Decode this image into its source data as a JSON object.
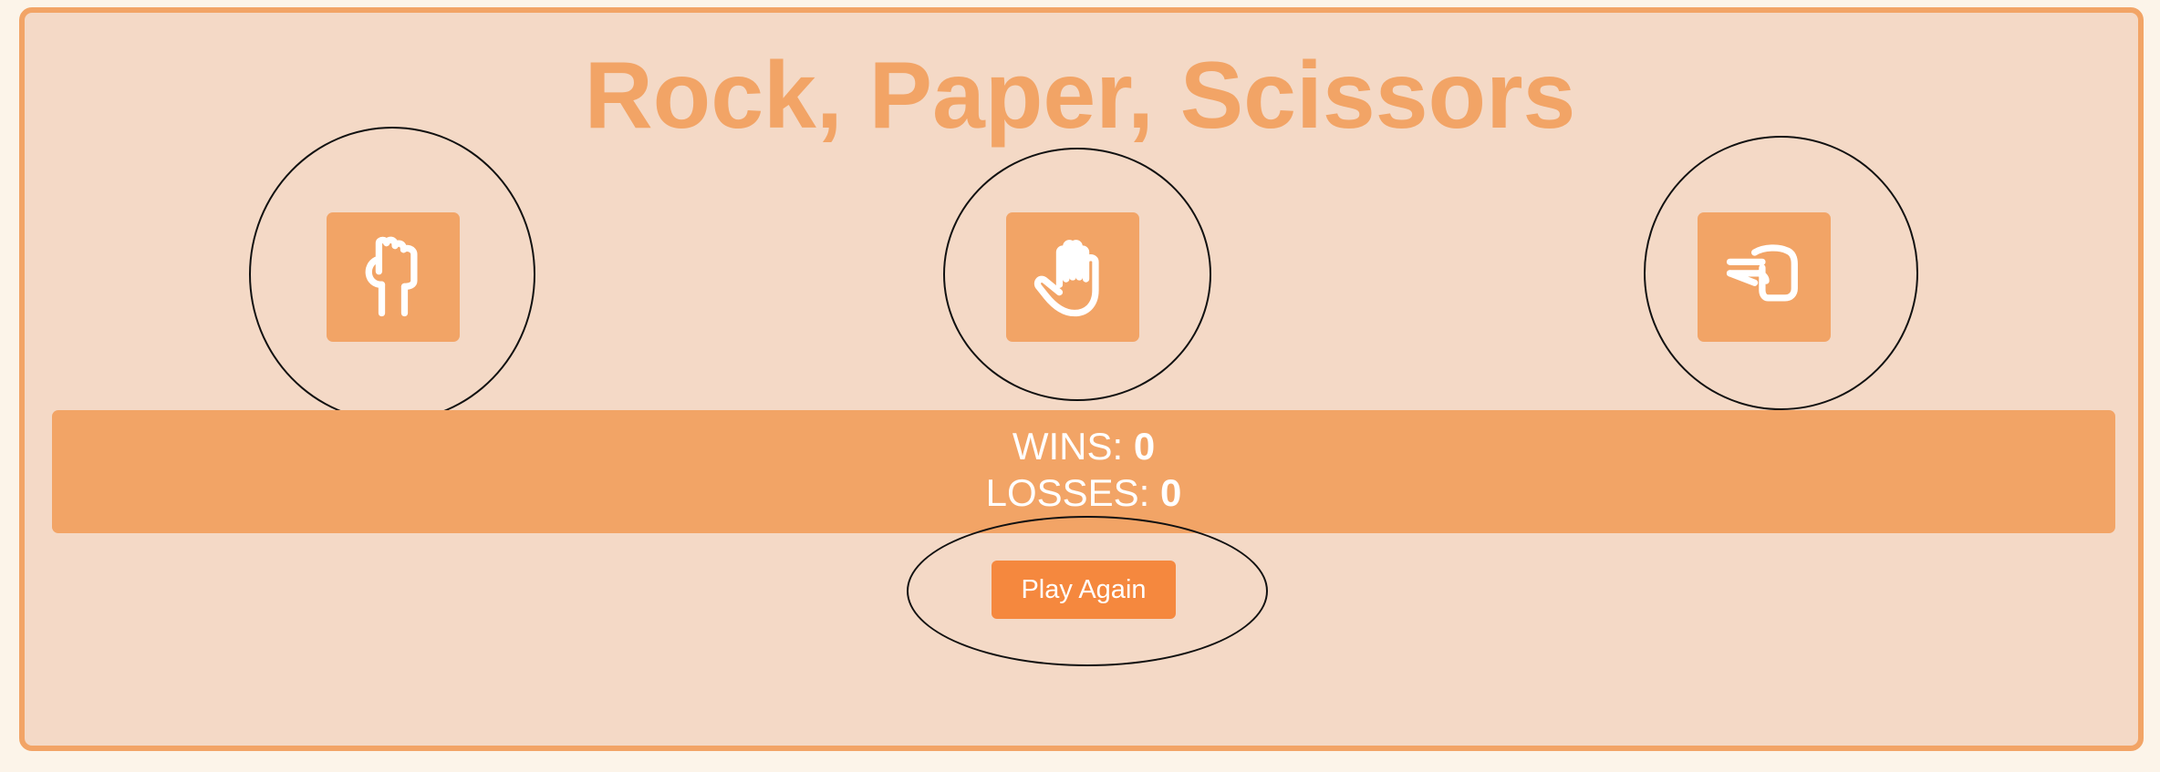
{
  "title": "Rock, Paper, Scissors",
  "choices": [
    {
      "name": "rock",
      "icon": "hand-fist-icon"
    },
    {
      "name": "paper",
      "icon": "hand-open-icon"
    },
    {
      "name": "scissors",
      "icon": "hand-scissors-icon"
    }
  ],
  "score": {
    "wins_label": "WINS:",
    "wins": "0",
    "losses_label": "LOSSES:",
    "losses": "0"
  },
  "play_again_label": "Play Again",
  "colors": {
    "page_background": "#fcf4e9",
    "panel_background": "#f4d9c6",
    "accent": "#f2a466",
    "button": "#f5883e",
    "text_on_accent": "#ffffff",
    "highlight_ring": "#111111"
  }
}
